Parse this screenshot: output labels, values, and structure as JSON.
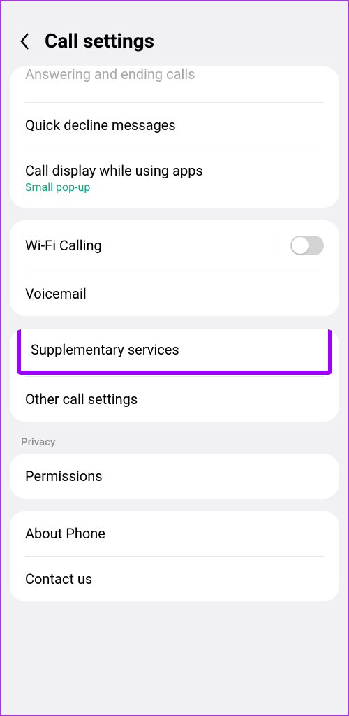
{
  "header": {
    "title": "Call settings"
  },
  "section1": {
    "truncated": "Answering and ending calls",
    "quick_decline": "Quick decline messages",
    "call_display": "Call display while using apps",
    "call_display_sub": "Small pop-up"
  },
  "section2": {
    "wifi_calling": "Wi-Fi Calling",
    "voicemail": "Voicemail"
  },
  "section3": {
    "supplementary": "Supplementary services",
    "other": "Other call settings"
  },
  "privacy_header": "Privacy",
  "section4": {
    "permissions": "Permissions"
  },
  "section5": {
    "about": "About Phone",
    "contact": "Contact us"
  }
}
